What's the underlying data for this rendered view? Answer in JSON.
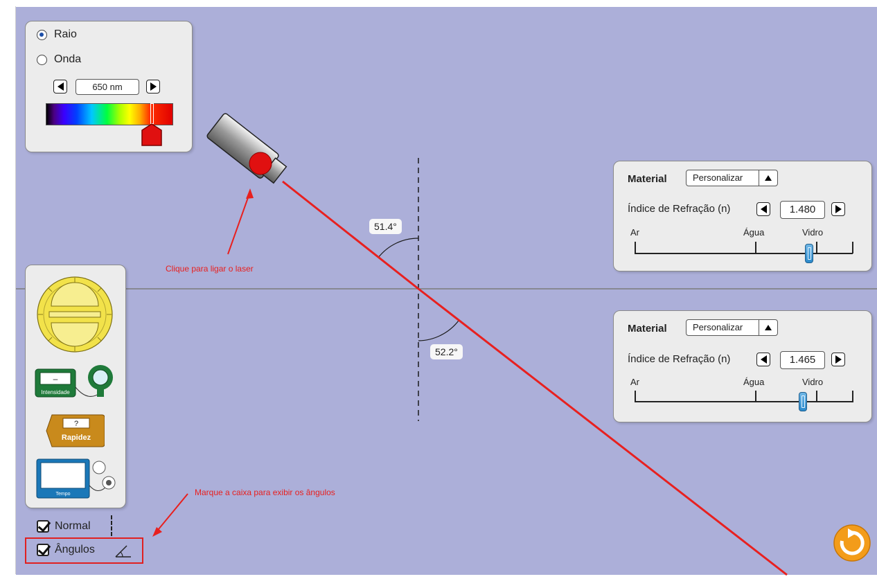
{
  "wave_panel": {
    "options": [
      "Raio",
      "Onda"
    ],
    "selected": "Raio",
    "wavelength": "650 nm"
  },
  "laser": {
    "annotation": "Clique para ligar o laser"
  },
  "angles": {
    "incident": "51.4°",
    "refracted": "52.2°"
  },
  "top_material": {
    "label": "Material",
    "dropdown": "Personalizar",
    "index_label": "Índice de Refração (n)",
    "index_value": "1.480",
    "scale_left": "Ar",
    "scale_mid": "Água",
    "scale_right": "Vidro",
    "slider_fraction": 0.8
  },
  "bottom_material": {
    "label": "Material",
    "dropdown": "Personalizar",
    "index_label": "Índice de Refração (n)",
    "index_value": "1.465",
    "scale_left": "Ar",
    "scale_mid": "Água",
    "scale_right": "Vidro",
    "slider_fraction": 0.77
  },
  "toolbox": {
    "intensity_label": "Intensidade",
    "intensity_readout": "–",
    "speed_readout": "?",
    "speed_label": "Rapidez",
    "time_label": "Tempo"
  },
  "checkboxes": {
    "normal_label": "Normal",
    "angles_label": "Ângulos"
  },
  "annotation_angles": "Marque a caixa para exibir os ângulos",
  "colors": {
    "background": "#acafd9",
    "laser_beam": "#e8201f",
    "annotation": "#e8201f",
    "slider_thumb": "#2a8acc",
    "reset_button": "#f39c1a"
  }
}
